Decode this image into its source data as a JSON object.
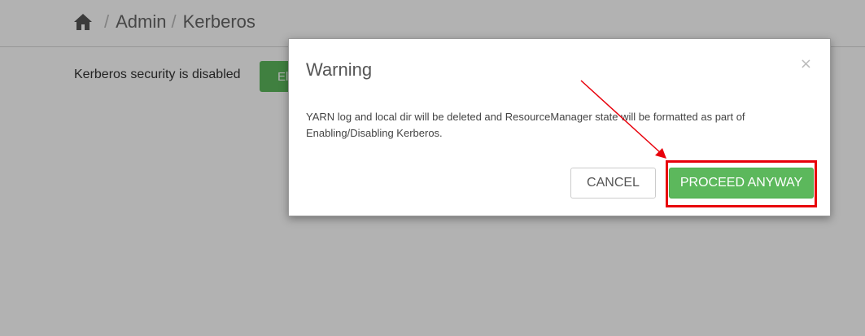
{
  "breadcrumb": {
    "items": [
      "Admin",
      "Kerberos"
    ],
    "separator": "/"
  },
  "page": {
    "status_text": "Kerberos security is disabled",
    "enable_button_label": "El"
  },
  "modal": {
    "title": "Warning",
    "close_symbol": "×",
    "message_line1": "YARN log and local dir will be deleted and ResourceManager state will be formatted as part of",
    "message_line2": "Enabling/Disabling Kerberos.",
    "cancel_label": "CANCEL",
    "proceed_label": "PROCEED ANYWAY"
  },
  "colors": {
    "accent_green": "#5cb85c",
    "annotation_red": "#e8000b"
  }
}
